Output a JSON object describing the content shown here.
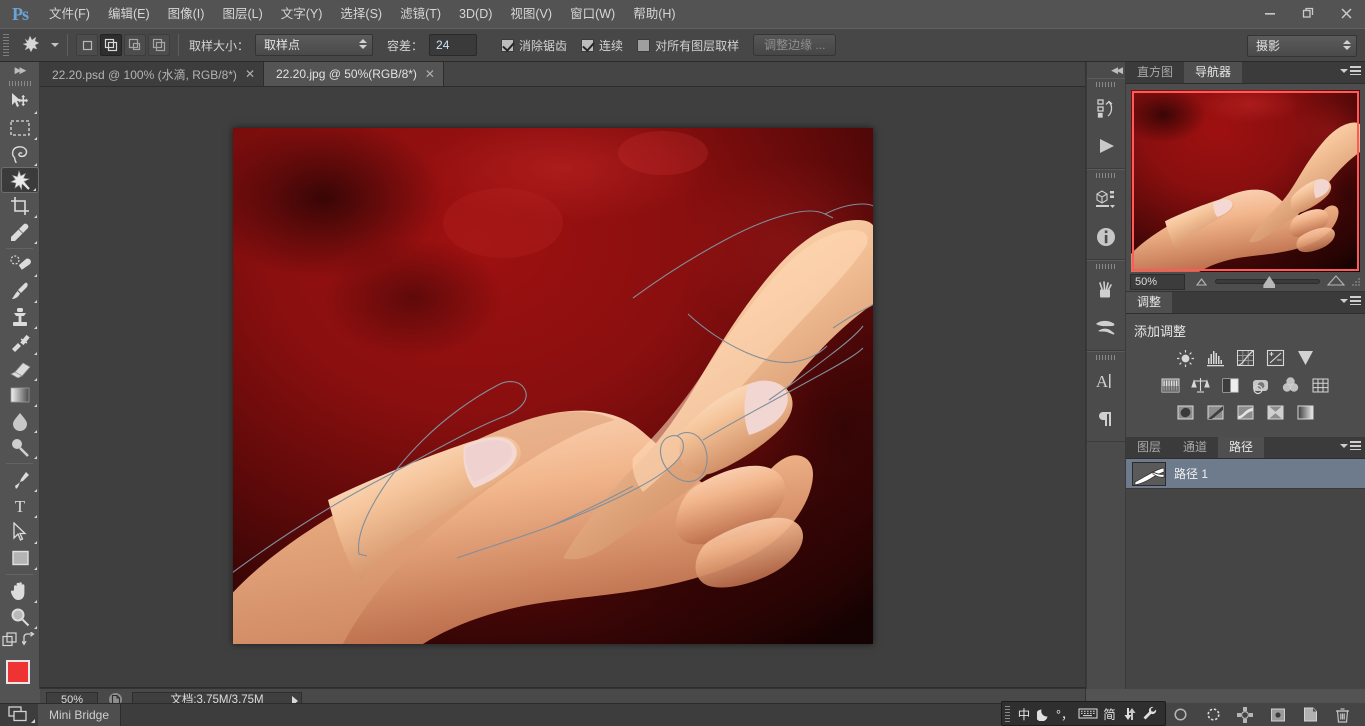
{
  "app": {
    "logo": "Ps"
  },
  "menubar": {
    "items": [
      {
        "label": "文件(F)",
        "name": "menu-file"
      },
      {
        "label": "编辑(E)",
        "name": "menu-edit"
      },
      {
        "label": "图像(I)",
        "name": "menu-image"
      },
      {
        "label": "图层(L)",
        "name": "menu-layer"
      },
      {
        "label": "文字(Y)",
        "name": "menu-type"
      },
      {
        "label": "选择(S)",
        "name": "menu-select"
      },
      {
        "label": "滤镜(T)",
        "name": "menu-filter"
      },
      {
        "label": "3D(D)",
        "name": "menu-3d"
      },
      {
        "label": "视图(V)",
        "name": "menu-view"
      },
      {
        "label": "窗口(W)",
        "name": "menu-window"
      },
      {
        "label": "帮助(H)",
        "name": "menu-help"
      }
    ]
  },
  "window_controls": {
    "minimize": "—",
    "restore": "❐",
    "close": "✕"
  },
  "options_bar": {
    "tool": "magic-wand-tool",
    "sample_size_label": "取样大小：",
    "sample_size_value": "取样点",
    "tolerance_label": "容差：",
    "tolerance_value": "24",
    "antialias_label": "消除锯齿",
    "antialias_checked": true,
    "contiguous_label": "连续",
    "contiguous_checked": true,
    "all_layers_label": "对所有图层取样",
    "all_layers_checked": false,
    "refine_edge_label": "调整边缘 ...",
    "selection_modes": [
      "new-selection",
      "add-to-selection",
      "subtract-from-selection",
      "intersect-with-selection"
    ],
    "selection_mode_active": 1,
    "workspace_value": "摄影"
  },
  "toolbar": {
    "tools": [
      {
        "name": "move-tool",
        "label": "移动工具"
      },
      {
        "name": "rectangular-marquee-tool",
        "label": "矩形选框工具"
      },
      {
        "name": "lasso-tool",
        "label": "套索工具"
      },
      {
        "name": "magic-wand-tool",
        "label": "魔棒工具"
      },
      {
        "name": "crop-tool",
        "label": "裁剪工具"
      },
      {
        "name": "eyedropper-tool",
        "label": "吸管工具"
      },
      {
        "name": "healing-brush-tool",
        "label": "污点修复画笔工具"
      },
      {
        "name": "brush-tool",
        "label": "画笔工具"
      },
      {
        "name": "clone-stamp-tool",
        "label": "仿制图章工具"
      },
      {
        "name": "history-brush-tool",
        "label": "历史记录画笔工具"
      },
      {
        "name": "eraser-tool",
        "label": "橡皮擦工具"
      },
      {
        "name": "gradient-tool",
        "label": "渐变工具"
      },
      {
        "name": "blur-tool",
        "label": "模糊工具"
      },
      {
        "name": "dodge-tool",
        "label": "减淡工具"
      },
      {
        "name": "pen-tool",
        "label": "钢笔工具"
      },
      {
        "name": "horizontal-type-tool",
        "label": "横排文字工具"
      },
      {
        "name": "path-selection-tool",
        "label": "路径选择工具"
      },
      {
        "name": "rectangle-tool",
        "label": "矩形工具"
      },
      {
        "name": "hand-tool",
        "label": "抓手工具"
      },
      {
        "name": "zoom-tool",
        "label": "缩放工具"
      }
    ],
    "active_tool_index": 3,
    "foreground_color": "#ef3232",
    "background_color": "#111111",
    "quick-mask-label": "以快速蒙版模式编辑"
  },
  "document_tabs": [
    {
      "label": "22.20.psd @ 100% (水滴, RGB/8*)",
      "active": false,
      "name": "doc-tab-psd"
    },
    {
      "label": "22.20.jpg @ 50%(RGB/8*)",
      "active": true,
      "name": "doc-tab-jpg"
    }
  ],
  "tab_close_glyph": "✕",
  "canvas": {
    "image_description": "两只手的照片，深红色背景，上面绘制了钢笔路径轮廓",
    "zoom": "50%"
  },
  "right_rail": {
    "groups": [
      {
        "icons": [
          {
            "name": "history-icon"
          },
          {
            "name": "actions-play-icon"
          }
        ]
      },
      {
        "icons": [
          {
            "name": "3d-object-icon"
          },
          {
            "name": "info-icon"
          }
        ]
      },
      {
        "icons": [
          {
            "name": "brush-presets-icon"
          },
          {
            "name": "brush-tip-icon"
          }
        ]
      },
      {
        "icons": [
          {
            "name": "character-icon"
          },
          {
            "name": "paragraph-icon"
          }
        ]
      }
    ]
  },
  "navigator_panel": {
    "tabs": [
      {
        "label": "直方图",
        "active": false,
        "name": "tab-histogram"
      },
      {
        "label": "导航器",
        "active": true,
        "name": "tab-navigator"
      }
    ],
    "zoom_value": "50%",
    "zoom_out_icon": "small-mountain-icon",
    "zoom_in_icon": "large-mountain-icon",
    "menu_icon": "panel-menu-icon"
  },
  "adjustments_panel": {
    "tab_label": "调整",
    "title": "添加调整",
    "rows": [
      [
        {
          "name": "brightness-contrast-icon"
        },
        {
          "name": "levels-icon"
        },
        {
          "name": "curves-icon"
        },
        {
          "name": "exposure-icon"
        },
        {
          "name": "vibrance-icon"
        }
      ],
      [
        {
          "name": "hue-saturation-icon"
        },
        {
          "name": "color-balance-icon"
        },
        {
          "name": "black-white-icon"
        },
        {
          "name": "photo-filter-icon"
        },
        {
          "name": "channel-mixer-icon"
        },
        {
          "name": "color-lookup-icon"
        }
      ],
      [
        {
          "name": "invert-icon"
        },
        {
          "name": "posterize-icon"
        },
        {
          "name": "threshold-icon"
        },
        {
          "name": "selective-color-icon"
        },
        {
          "name": "gradient-map-icon"
        }
      ]
    ]
  },
  "layers_panel": {
    "tabs": [
      {
        "label": "图层",
        "active": false,
        "name": "tab-layers"
      },
      {
        "label": "通道",
        "active": false,
        "name": "tab-channels"
      },
      {
        "label": "路径",
        "active": true,
        "name": "tab-paths"
      }
    ],
    "paths": [
      {
        "name": "路径 1",
        "selected": true
      }
    ]
  },
  "panel_footer": {
    "icons": [
      {
        "name": "fill-path-icon"
      },
      {
        "name": "stroke-path-icon"
      },
      {
        "name": "load-selection-icon"
      },
      {
        "name": "make-work-path-icon"
      },
      {
        "name": "new-path-icon"
      },
      {
        "name": "duplicate-path-icon"
      },
      {
        "name": "delete-path-icon"
      }
    ]
  },
  "status_bar": {
    "zoom": "50%",
    "doc_info": "文档:3.75M/3.75M",
    "preview_icon": "preview-icon",
    "expand_arrow": "▶"
  },
  "bottom_bar": {
    "mini_bridge_label": "Mini Bridge",
    "launch_icon": "launch-bridge-icon"
  },
  "ime_bar": {
    "items": [
      {
        "glyph": "中",
        "name": "ime-chinese-mode"
      },
      {
        "glyph": "☽",
        "name": "ime-moon-icon"
      },
      {
        "glyph": "°，",
        "name": "ime-punctuation-icon"
      },
      {
        "glyph": "⌨",
        "name": "ime-keyboard-icon"
      },
      {
        "glyph": "简",
        "name": "ime-simplified-icon"
      },
      {
        "glyph": "⇅",
        "name": "ime-soft-keyboard-icon"
      },
      {
        "glyph": "🔧",
        "name": "ime-settings-icon"
      }
    ]
  }
}
